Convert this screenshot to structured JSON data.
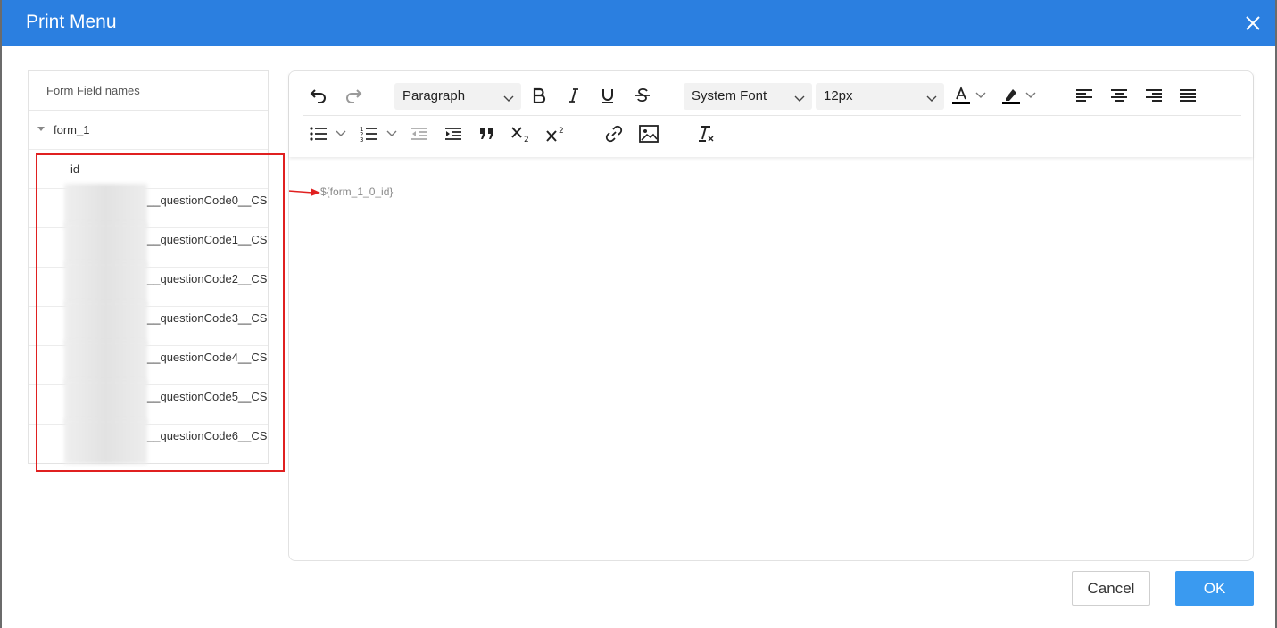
{
  "dialog": {
    "title": "Print Menu"
  },
  "tree": {
    "header": "Form Field names",
    "root": "form_1",
    "fields": [
      "id",
      "__questionCode0__CS",
      "__questionCode1__CS",
      "__questionCode2__CS",
      "__questionCode3__CS",
      "__questionCode4__CS",
      "__questionCode5__CS",
      "__questionCode6__CS"
    ]
  },
  "toolbar": {
    "block_format": "Paragraph",
    "font_family": "System Font",
    "font_size": "12px"
  },
  "editor": {
    "content": "${form_1_0_id}"
  },
  "buttons": {
    "cancel": "Cancel",
    "ok": "OK"
  },
  "colors": {
    "title_bar": "#2b7fe0",
    "ok_button": "#3a9af0",
    "highlight": "#e02020"
  }
}
